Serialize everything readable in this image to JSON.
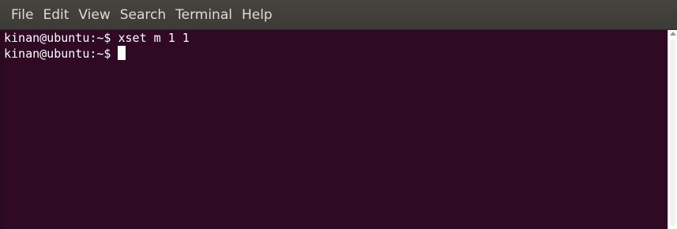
{
  "menubar": {
    "items": [
      {
        "label": "File"
      },
      {
        "label": "Edit"
      },
      {
        "label": "View"
      },
      {
        "label": "Search"
      },
      {
        "label": "Terminal"
      },
      {
        "label": "Help"
      }
    ]
  },
  "terminal": {
    "lines": [
      {
        "text": "kinan@ubuntu:~$ xset m 1 1"
      },
      {
        "text": "kinan@ubuntu:~$"
      }
    ],
    "background_color": "#300a24",
    "text_color": "#ffffff"
  },
  "icons": {
    "scroll_up": "scroll-up-arrow-icon"
  }
}
